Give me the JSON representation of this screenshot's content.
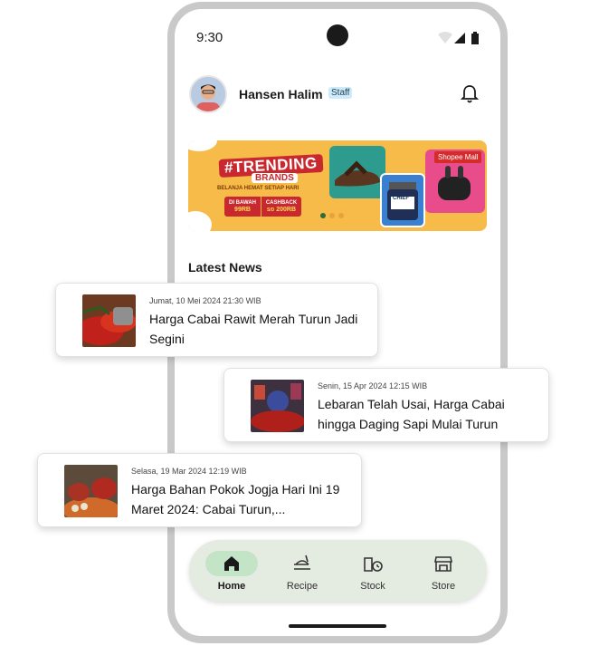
{
  "status_bar": {
    "time": "9:30"
  },
  "header": {
    "user_name": "Hansen Halim",
    "role_badge": "Staff"
  },
  "banner": {
    "headline": "#TRENDING",
    "subheadline": "BRANDS",
    "tagline": "BELANJA HEMAT SETIAP HARI",
    "promo_left_top": "DI BAWAH",
    "promo_left_value": "99RB",
    "promo_right_top": "CASHBACK",
    "promo_right_mid": "S/D",
    "promo_right_value": "200RB",
    "mall_label": "Shopee Mall",
    "product_label": "CHIEF"
  },
  "news": {
    "section_title": "Latest News",
    "items": [
      {
        "date": "Jumat, 10 Mei 2024 21:30 WIB",
        "title": "Harga Cabai Rawit Merah Turun Jadi Segini"
      },
      {
        "date": "Senin, 15 Apr 2024 12:15 WIB",
        "title": "Lebaran Telah Usai, Harga Cabai hingga Daging Sapi Mulai Turun"
      },
      {
        "date": "Selasa, 19 Mar 2024 12:19 WIB",
        "title": "Harga Bahan Pokok Jogja Hari Ini 19 Maret 2024: Cabai Turun,..."
      }
    ]
  },
  "bottom_nav": {
    "items": [
      {
        "label": "Home",
        "icon": "home-icon",
        "active": true
      },
      {
        "label": "Recipe",
        "icon": "recipe-icon",
        "active": false
      },
      {
        "label": "Stock",
        "icon": "stock-icon",
        "active": false
      },
      {
        "label": "Store",
        "icon": "store-icon",
        "active": false
      }
    ]
  },
  "colors": {
    "nav_background": "#e4ebe1",
    "nav_active_pill": "#c4e4c8",
    "badge_background": "#cfeaf9",
    "banner_background": "#f7bb4a"
  }
}
